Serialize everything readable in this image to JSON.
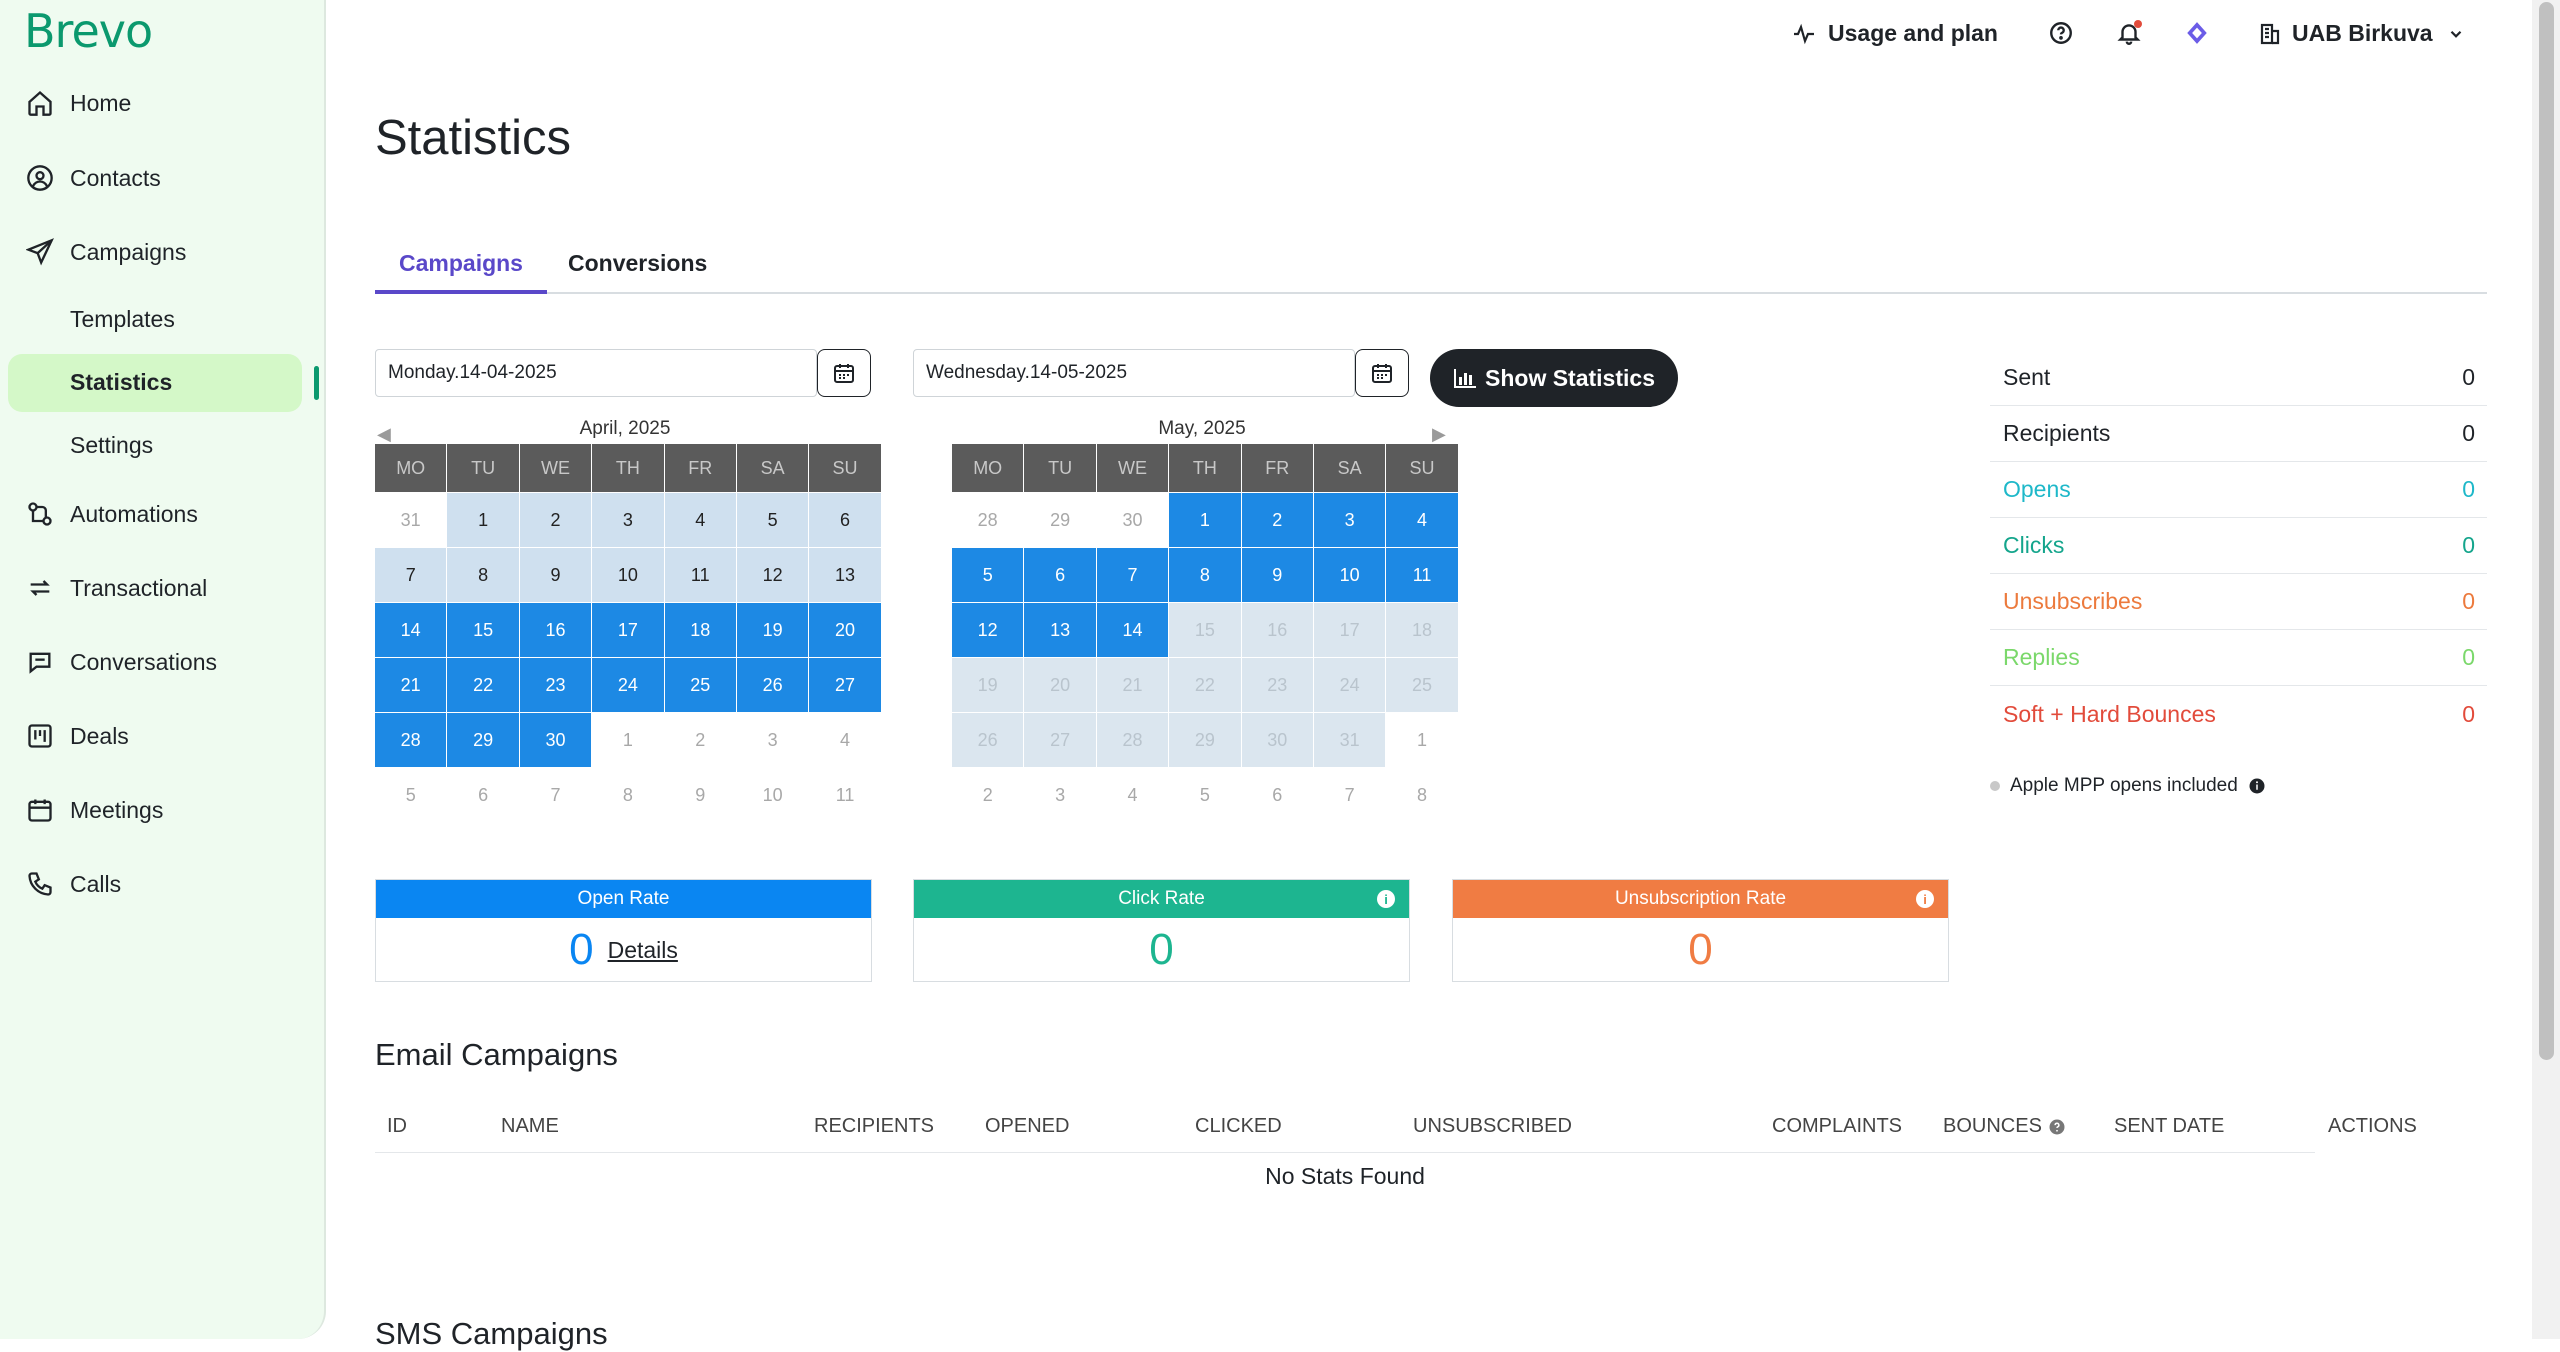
{
  "app": {
    "logo": "Brevo"
  },
  "sidebar": {
    "items": [
      {
        "label": "Home",
        "icon": "home-icon"
      },
      {
        "label": "Contacts",
        "icon": "user-circle-icon"
      },
      {
        "label": "Campaigns",
        "icon": "paper-plane-icon"
      },
      {
        "label": "Automations",
        "icon": "automation-icon"
      },
      {
        "label": "Transactional",
        "icon": "repeat-arrows-icon"
      },
      {
        "label": "Conversations",
        "icon": "chat-bubble-icon"
      },
      {
        "label": "Deals",
        "icon": "kanban-board-icon"
      },
      {
        "label": "Meetings",
        "icon": "calendar-icon"
      },
      {
        "label": "Calls",
        "icon": "phone-icon"
      }
    ],
    "sub_items": [
      {
        "label": "Templates"
      },
      {
        "label": "Statistics",
        "active": true
      },
      {
        "label": "Settings"
      }
    ]
  },
  "topbar": {
    "usage_label": "Usage and plan",
    "account_label": "UAB Birkuva",
    "icons": [
      "activity-icon",
      "help-icon",
      "bell-icon",
      "diamond-icon",
      "building-icon",
      "chevron-down-icon"
    ]
  },
  "page": {
    "title": "Statistics"
  },
  "tabs": [
    {
      "label": "Campaigns",
      "active": true
    },
    {
      "label": "Conversions",
      "active": false
    }
  ],
  "date_range": {
    "start": "Monday.14-04-2025",
    "end": "Wednesday.14-05-2025",
    "show_button": "Show Statistics"
  },
  "calendars": [
    {
      "month": "April, 2025",
      "weekdays": [
        "MO",
        "TU",
        "WE",
        "TH",
        "FR",
        "SA",
        "SU"
      ],
      "weeks": [
        [
          "31",
          "1",
          "2",
          "3",
          "4",
          "5",
          "6"
        ],
        [
          "7",
          "8",
          "9",
          "10",
          "11",
          "12",
          "13"
        ],
        [
          "14",
          "15",
          "16",
          "17",
          "18",
          "19",
          "20"
        ],
        [
          "21",
          "22",
          "23",
          "24",
          "25",
          "26",
          "27"
        ],
        [
          "28",
          "29",
          "30",
          "1",
          "2",
          "3",
          "4"
        ],
        [
          "5",
          "6",
          "7",
          "8",
          "9",
          "10",
          "11"
        ]
      ],
      "states": [
        [
          "other",
          "light",
          "light",
          "light",
          "light",
          "light",
          "light"
        ],
        [
          "light",
          "light",
          "light",
          "light",
          "light",
          "light",
          "light"
        ],
        [
          "sel",
          "sel",
          "sel",
          "sel",
          "sel",
          "sel",
          "sel"
        ],
        [
          "sel",
          "sel",
          "sel",
          "sel",
          "sel",
          "sel",
          "sel"
        ],
        [
          "sel",
          "sel",
          "sel",
          "other",
          "other",
          "other",
          "other"
        ],
        [
          "other",
          "other",
          "other",
          "other",
          "other",
          "other",
          "other"
        ]
      ]
    },
    {
      "month": "May, 2025",
      "weekdays": [
        "MO",
        "TU",
        "WE",
        "TH",
        "FR",
        "SA",
        "SU"
      ],
      "weeks": [
        [
          "28",
          "29",
          "30",
          "1",
          "2",
          "3",
          "4"
        ],
        [
          "5",
          "6",
          "7",
          "8",
          "9",
          "10",
          "11"
        ],
        [
          "12",
          "13",
          "14",
          "15",
          "16",
          "17",
          "18"
        ],
        [
          "19",
          "20",
          "21",
          "22",
          "23",
          "24",
          "25"
        ],
        [
          "26",
          "27",
          "28",
          "29",
          "30",
          "31",
          "1"
        ],
        [
          "2",
          "3",
          "4",
          "5",
          "6",
          "7",
          "8"
        ]
      ],
      "states": [
        [
          "other",
          "other",
          "other",
          "sel",
          "sel",
          "sel",
          "sel"
        ],
        [
          "sel",
          "sel",
          "sel",
          "sel",
          "sel",
          "sel",
          "sel"
        ],
        [
          "sel",
          "sel",
          "sel",
          "fade",
          "fade",
          "fade",
          "fade"
        ],
        [
          "fade",
          "fade",
          "fade",
          "fade",
          "fade",
          "fade",
          "fade"
        ],
        [
          "fade",
          "fade",
          "fade",
          "fade",
          "fade",
          "fade",
          "other"
        ],
        [
          "other",
          "other",
          "other",
          "other",
          "other",
          "other",
          "other"
        ]
      ]
    }
  ],
  "summary": [
    {
      "label": "Sent",
      "value": "0",
      "color": "#1f2328"
    },
    {
      "label": "Recipients",
      "value": "0",
      "color": "#1f2328"
    },
    {
      "label": "Opens",
      "value": "0",
      "color": "#1eb8c9"
    },
    {
      "label": "Clicks",
      "value": "0",
      "color": "#14a58c"
    },
    {
      "label": "Unsubscribes",
      "value": "0",
      "color": "#ec7a3d"
    },
    {
      "label": "Replies",
      "value": "0",
      "color": "#7bd86b"
    },
    {
      "label": "Soft + Hard Bounces",
      "value": "0",
      "color": "#e24b3b"
    }
  ],
  "mpp_note": "Apple MPP opens included",
  "rates": [
    {
      "label": "Open Rate",
      "value": "0",
      "link": "Details",
      "color": "#0a86f2",
      "info": false
    },
    {
      "label": "Click Rate",
      "value": "0",
      "color": "#1db590",
      "info": true
    },
    {
      "label": "Unsubscription Rate",
      "value": "0",
      "color": "#f07c43",
      "info": true
    }
  ],
  "email_campaigns": {
    "title": "Email Campaigns",
    "columns": [
      "ID",
      "NAME",
      "RECIPIENTS",
      "OPENED",
      "CLICKED",
      "UNSUBSCRIBED",
      "COMPLAINTS",
      "BOUNCES",
      "SENT DATE",
      "ACTIONS"
    ],
    "empty": "No Stats Found"
  },
  "sms_campaigns": {
    "title": "SMS Campaigns"
  }
}
